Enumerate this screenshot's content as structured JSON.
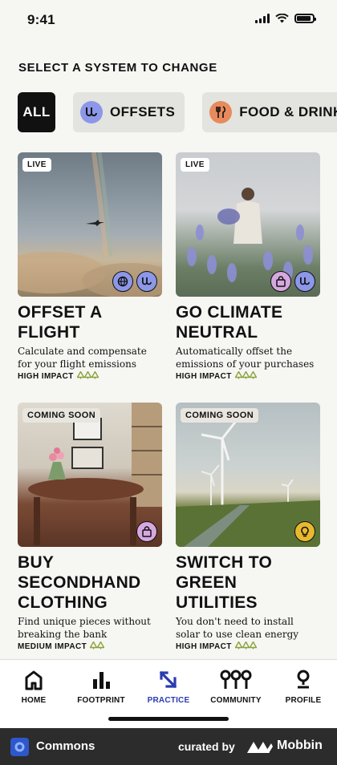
{
  "status_bar": {
    "time": "9:41",
    "battery_level": 0.9
  },
  "page": {
    "title": "SELECT A SYSTEM TO CHANGE"
  },
  "filters": [
    {
      "label": "ALL",
      "selected": true
    },
    {
      "label": "OFFSETS",
      "icon": "offsets-icon",
      "icon_color": "#8c97e8"
    },
    {
      "label": "FOOD & DRINK",
      "icon": "utensils-icon",
      "icon_color": "#e88a5c"
    }
  ],
  "cards": [
    {
      "badge": "LIVE",
      "title": "OFFSET A FLIGHT",
      "description": "Calculate and compensate for your flight emissions",
      "impact": "HIGH IMPACT",
      "impact_marks": 3,
      "icons": [
        "globe-icon",
        "offsets-icon"
      ]
    },
    {
      "badge": "LIVE",
      "title": "GO CLIMATE NEUTRAL",
      "description": "Automatically offset the emissions of your purchases",
      "impact": "HIGH IMPACT",
      "impact_marks": 3,
      "icons": [
        "shopping-bag-icon",
        "offsets-icon"
      ]
    },
    {
      "badge": "COMING SOON",
      "title": "BUY SECONDHAND CLOTHING",
      "description": "Find unique pieces without breaking the bank",
      "impact": "MEDIUM IMPACT",
      "impact_marks": 2,
      "icons": [
        "shopping-bag-icon"
      ]
    },
    {
      "badge": "COMING SOON",
      "title": "SWITCH TO GREEN UTILITIES",
      "description": "You don't need to install solar to use clean energy",
      "impact": "HIGH IMPACT",
      "impact_marks": 3,
      "icons": [
        "lightbulb-icon"
      ]
    }
  ],
  "tabbar": {
    "items": [
      {
        "label": "HOME",
        "icon": "home-icon"
      },
      {
        "label": "FOOTPRINT",
        "icon": "bar-chart-icon"
      },
      {
        "label": "PRACTICE",
        "icon": "practice-icon",
        "active": true
      },
      {
        "label": "COMMUNITY",
        "icon": "community-icon"
      },
      {
        "label": "PROFILE",
        "icon": "profile-icon"
      }
    ]
  },
  "footer": {
    "app_name": "Commons",
    "curated_by": "curated by",
    "brand": "Mobbin"
  },
  "colors": {
    "accent": "#2a3bb0",
    "impact_green": "#8aa23a",
    "offsets": "#8c97e8",
    "food": "#e88a5c",
    "bag": "#d7a8e0",
    "bulb": "#e8b92e"
  }
}
